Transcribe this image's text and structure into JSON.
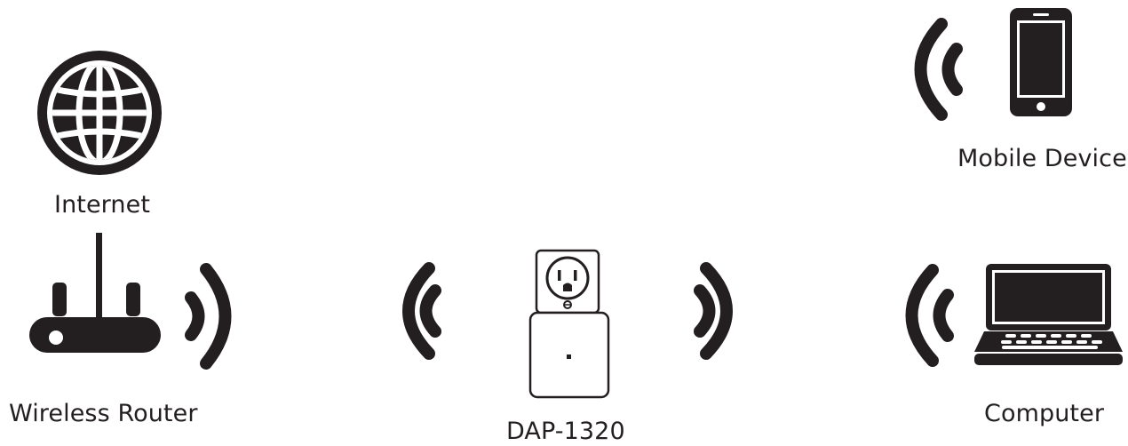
{
  "labels": {
    "internet": "Internet",
    "wireless_router": "Wireless Router",
    "extender": "DAP-1320",
    "mobile_device": "Mobile Device",
    "computer": "Computer"
  },
  "colors": {
    "ink": "#231f20",
    "background": "#ffffff"
  },
  "icons": {
    "internet": "globe-icon",
    "wireless_router": "router-icon",
    "extender": "plug-in-extender-icon",
    "mobile_device": "smartphone-icon",
    "computer": "laptop-icon",
    "signal": "wifi-signal-waves-icon"
  }
}
